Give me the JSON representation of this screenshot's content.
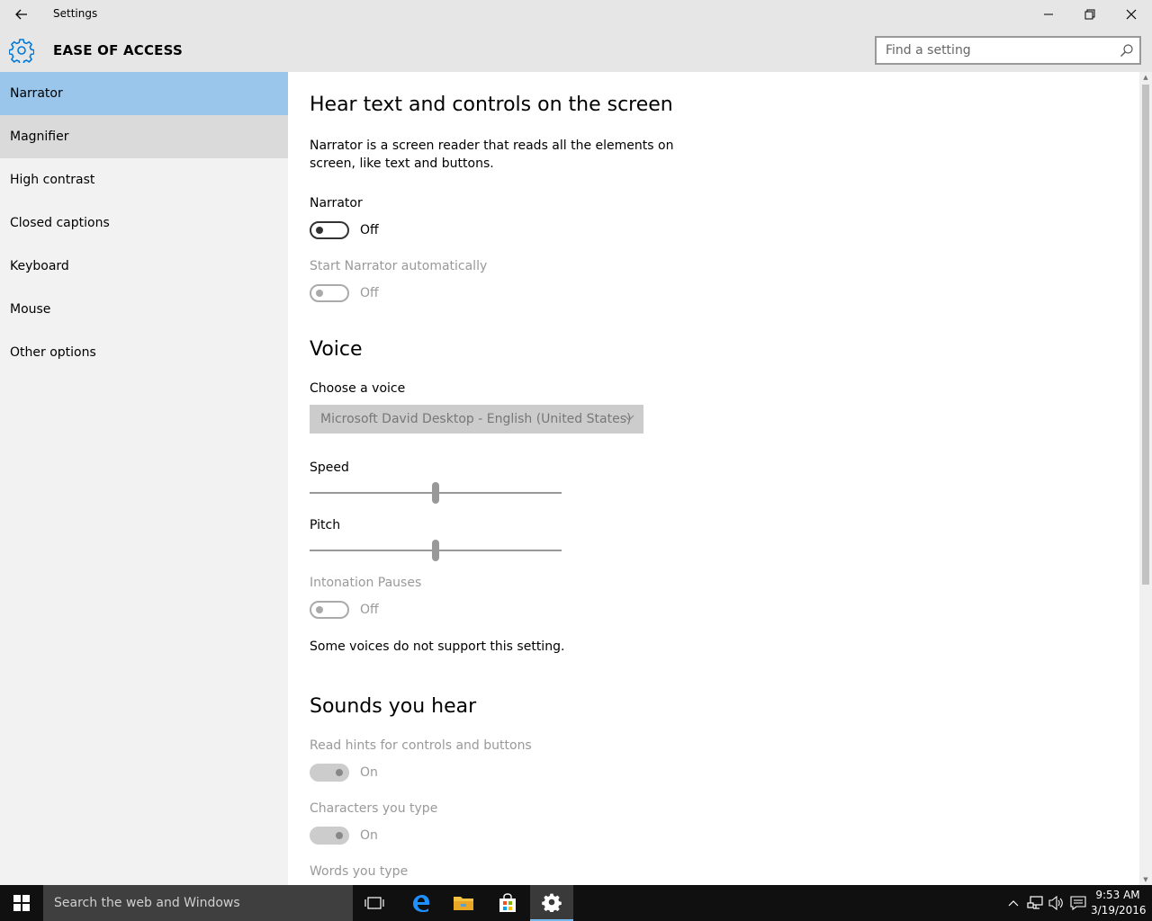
{
  "window": {
    "title": "Settings",
    "section_title": "EASE OF ACCESS"
  },
  "search": {
    "placeholder": "Find a setting"
  },
  "sidebar": {
    "items": [
      {
        "label": "Narrator",
        "state": "selected"
      },
      {
        "label": "Magnifier",
        "state": "hover"
      },
      {
        "label": "High contrast",
        "state": "normal"
      },
      {
        "label": "Closed captions",
        "state": "normal"
      },
      {
        "label": "Keyboard",
        "state": "normal"
      },
      {
        "label": "Mouse",
        "state": "normal"
      },
      {
        "label": "Other options",
        "state": "normal"
      }
    ]
  },
  "content": {
    "heading": "Hear text and controls on the screen",
    "description": "Narrator is a screen reader that reads all the elements on screen, like text and buttons.",
    "narrator": {
      "label": "Narrator",
      "state": "Off",
      "on": false
    },
    "start_auto": {
      "label": "Start Narrator automatically",
      "state": "Off",
      "on": false,
      "disabled": true
    },
    "voice_heading": "Voice",
    "choose_voice": {
      "label": "Choose a voice",
      "value": "Microsoft David Desktop - English (United States)"
    },
    "speed": {
      "label": "Speed",
      "level": 0.5
    },
    "pitch": {
      "label": "Pitch",
      "level": 0.5
    },
    "intonation": {
      "label": "Intonation Pauses",
      "state": "Off",
      "on": false,
      "disabled": true
    },
    "voices_note": "Some voices do not support this setting.",
    "sounds_heading": "Sounds you hear",
    "read_hints": {
      "label": "Read hints for controls and buttons",
      "state": "On",
      "on": true,
      "disabled": true
    },
    "chars_typed": {
      "label": "Characters you type",
      "state": "On",
      "on": true,
      "disabled": true
    },
    "words_typed": {
      "label": "Words you type"
    }
  },
  "taskbar": {
    "search_placeholder": "Search the web and Windows",
    "time": "9:53 AM",
    "date": "3/19/2016"
  },
  "colors": {
    "accent": "#0078d7",
    "selected_nav": "#99c6ea",
    "taskbar": "#101010"
  }
}
